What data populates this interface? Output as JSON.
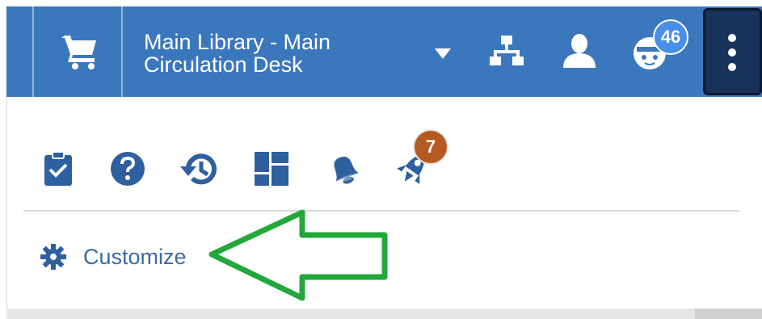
{
  "topbar": {
    "location_label": "Main Library - Main Circulation Desk",
    "notifications_badge": "46",
    "colors": {
      "background": "#3b77bd",
      "more_button": "#17325b",
      "badge": "#4a8fe7"
    }
  },
  "icons": {
    "cart": "shopping-cart-icon",
    "caret": "caret-down-icon",
    "sitemap": "sitemap-icon",
    "user": "user-icon",
    "notifications": "notifications-face-icon",
    "more": "vertical-ellipsis-icon"
  },
  "panel": {
    "icons": [
      {
        "name": "clipboard-check-icon"
      },
      {
        "name": "help-icon"
      },
      {
        "name": "history-icon"
      },
      {
        "name": "widgets-icon"
      },
      {
        "name": "bell-icon"
      },
      {
        "name": "rocket-icon",
        "badge": "7"
      }
    ],
    "customize_label": "Customize",
    "customize_icon": "gear-icon",
    "colors": {
      "icon": "#2e5f9e",
      "link": "#3d6aa6",
      "badge": "#b55a22",
      "annotation_arrow": "#22a83a"
    }
  }
}
